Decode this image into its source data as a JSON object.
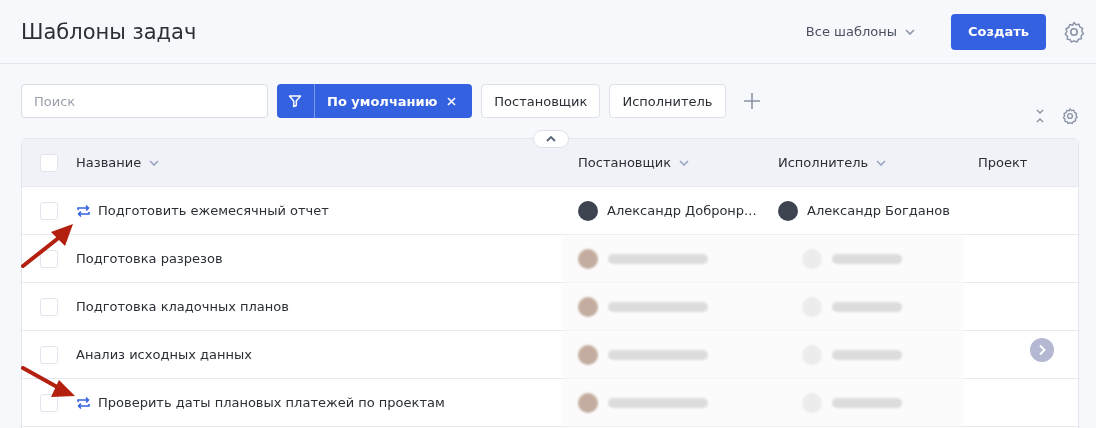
{
  "header": {
    "title": "Шаблоны задач",
    "view_dropdown": "Все шаблоны",
    "create_button": "Создать"
  },
  "filters": {
    "search": {
      "placeholder": "Поиск"
    },
    "preset": {
      "label": "По умолчанию"
    },
    "chips": [
      "Постановщик",
      "Исполнитель"
    ]
  },
  "table": {
    "select_all_checked": false,
    "columns": [
      {
        "label": "Название",
        "sortable": true
      },
      {
        "label": "Постановщик",
        "sortable": true
      },
      {
        "label": "Исполнитель",
        "sortable": true
      },
      {
        "label": "Проект",
        "sortable": false
      }
    ],
    "rows": [
      {
        "name": "Подготовить ежемесячный отчет",
        "recurring": true,
        "checked": false,
        "blurred": false,
        "author": "Александр Добронр...",
        "assignee": "Александр Богданов"
      },
      {
        "name": "Подготовка разрезов",
        "recurring": false,
        "checked": false,
        "blurred": true
      },
      {
        "name": "Подготовка кладочных планов",
        "recurring": false,
        "checked": false,
        "blurred": true
      },
      {
        "name": "Анализ исходных данных",
        "recurring": false,
        "checked": false,
        "blurred": true
      },
      {
        "name": "Проверить даты плановых платежей по проектам",
        "recurring": true,
        "checked": false,
        "blurred": true
      }
    ]
  }
}
